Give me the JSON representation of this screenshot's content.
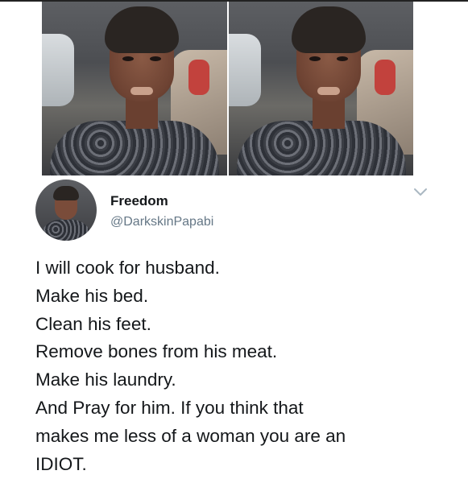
{
  "tweet": {
    "display_name": "Freedom",
    "handle": "@DarkskinPapabi",
    "lines": [
      "I will cook for husband.",
      "Make his bed.",
      "Clean his feet.",
      "Remove bones from his meat.",
      "Make his laundry.",
      "And Pray for him. If you think that",
      "makes me less of a woman you are an",
      "IDIOT."
    ]
  },
  "icons": {
    "menu": "chevron-down-icon"
  },
  "colors": {
    "text": "#14171a",
    "handle": "#657786",
    "chevron": "#aab8c2"
  }
}
